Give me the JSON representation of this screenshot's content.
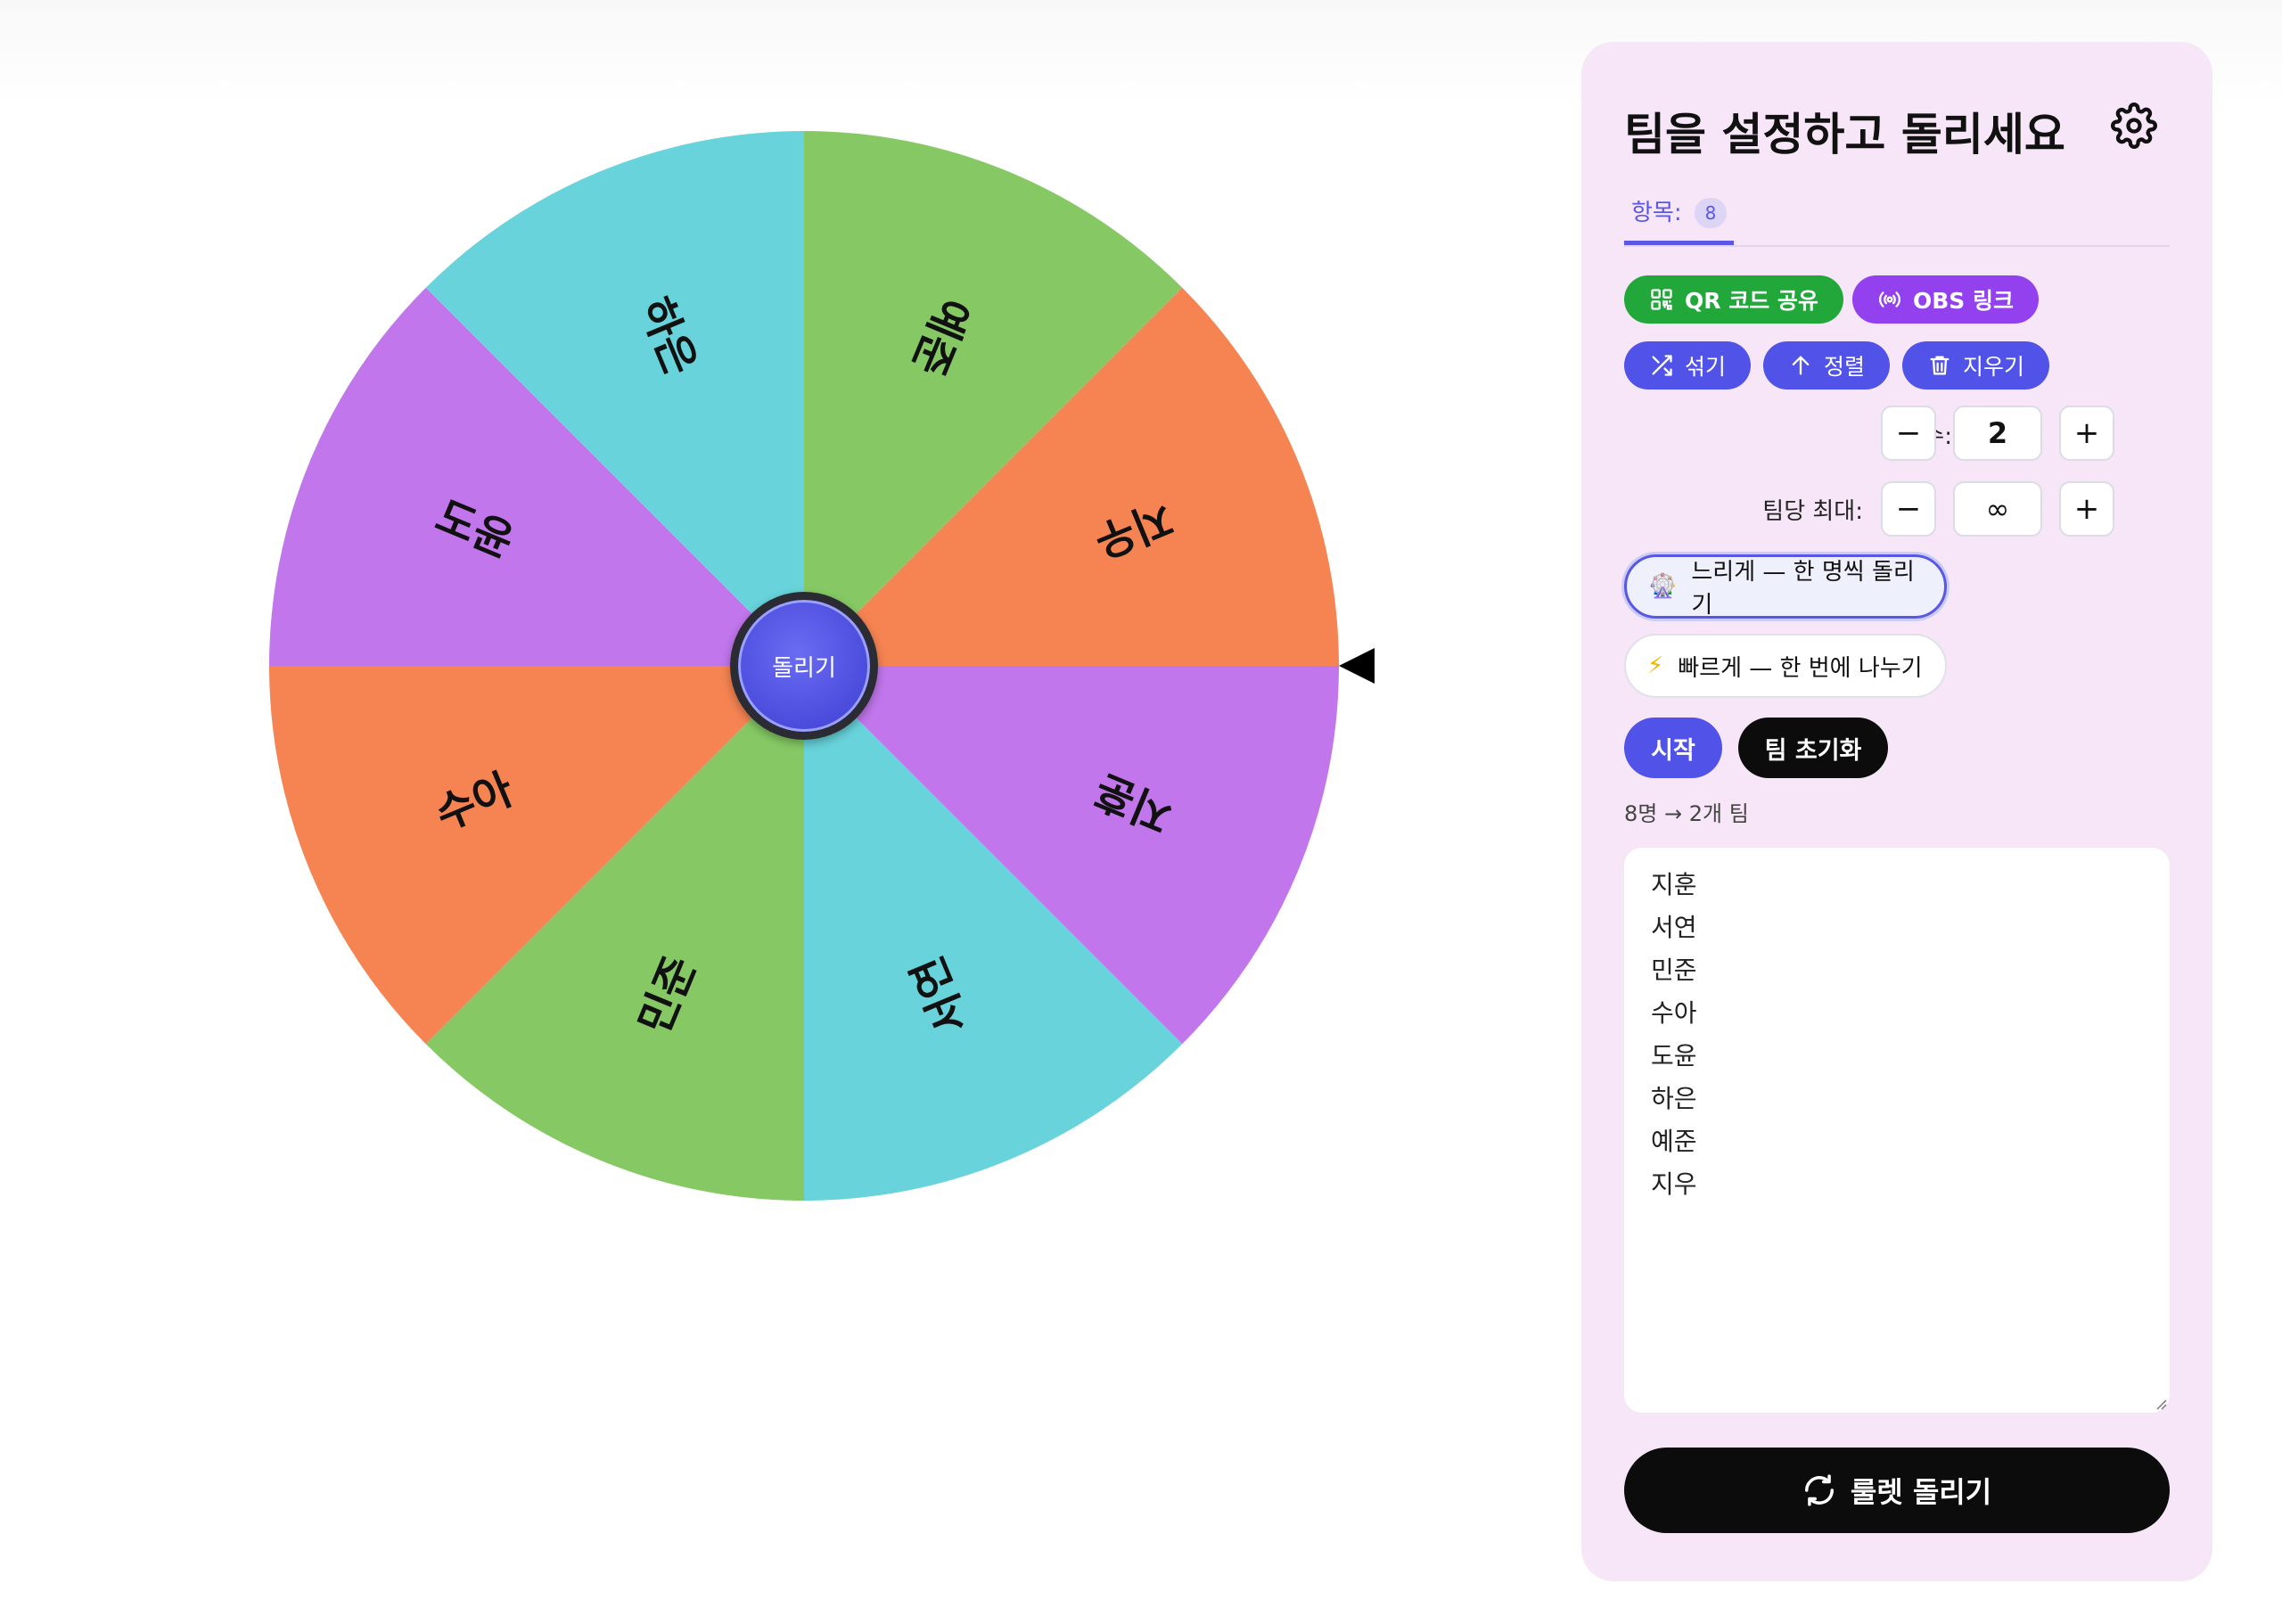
{
  "wheel": {
    "center_label": "돌리기",
    "segments": [
      {
        "label": "예준",
        "color": "#86c964"
      },
      {
        "label": "지우",
        "color": "#f58452"
      },
      {
        "label": "지훈",
        "color": "#c176eb"
      },
      {
        "label": "서연",
        "color": "#68d3db"
      },
      {
        "label": "민준",
        "color": "#86c964"
      },
      {
        "label": "수아",
        "color": "#f58452"
      },
      {
        "label": "도윤",
        "color": "#c176eb"
      },
      {
        "label": "하은",
        "color": "#68d3db"
      }
    ]
  },
  "panel": {
    "title": "팀을 설정하고 돌리세요",
    "tab": {
      "label": "항목:",
      "count": "8"
    },
    "actions": {
      "qr": "QR 코드 공유",
      "obs": "OBS 링크",
      "shuffle": "섞기",
      "sort": "정렬",
      "clear": "지우기"
    },
    "team_count": {
      "label": "팀 수:",
      "value": "2",
      "minus": "−",
      "plus": "+"
    },
    "max_per_team": {
      "label": "팀당 최대:",
      "value": "∞",
      "minus": "−",
      "plus": "+"
    },
    "modes": {
      "slow": {
        "icon": "🎡",
        "label": "느리게 — 한 명씩 돌리기"
      },
      "fast": {
        "icon": "⚡",
        "label": "빠르게 — 한 번에 나누기"
      }
    },
    "start": "시작",
    "reset": "팀 초기화",
    "summary": "8명 → 2개 팀",
    "names": [
      "지훈",
      "서연",
      "민준",
      "수아",
      "도윤",
      "하은",
      "예준",
      "지우"
    ],
    "spin_button": "룰렛 돌리기"
  },
  "colors": {
    "accent": "#5153e8",
    "green": "#22a83a",
    "purple": "#9340ee",
    "panel_bg": "#f6e6f7"
  }
}
